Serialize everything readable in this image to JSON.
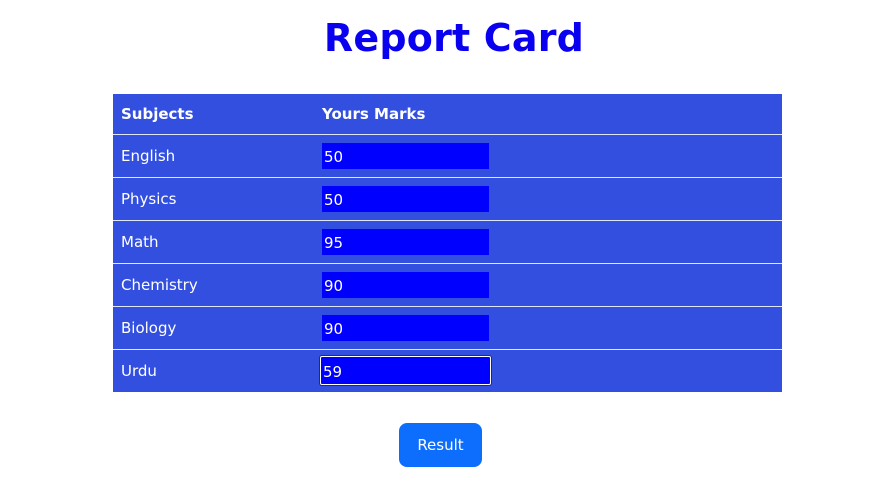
{
  "page": {
    "title": "Report Card"
  },
  "table": {
    "headers": {
      "subjects": "Subjects",
      "marks": "Yours Marks"
    },
    "rows": [
      {
        "subject": "English",
        "marks": "50"
      },
      {
        "subject": "Physics",
        "marks": "50"
      },
      {
        "subject": "Math",
        "marks": "95"
      },
      {
        "subject": "Chemistry",
        "marks": "90"
      },
      {
        "subject": "Biology",
        "marks": "90"
      },
      {
        "subject": "Urdu",
        "marks": "59"
      }
    ]
  },
  "actions": {
    "result_label": "Result"
  },
  "colors": {
    "title": "#0a00f0",
    "table_bg": "#334fe0",
    "input_bg": "#0000ff",
    "button_bg": "#0d6efd"
  }
}
